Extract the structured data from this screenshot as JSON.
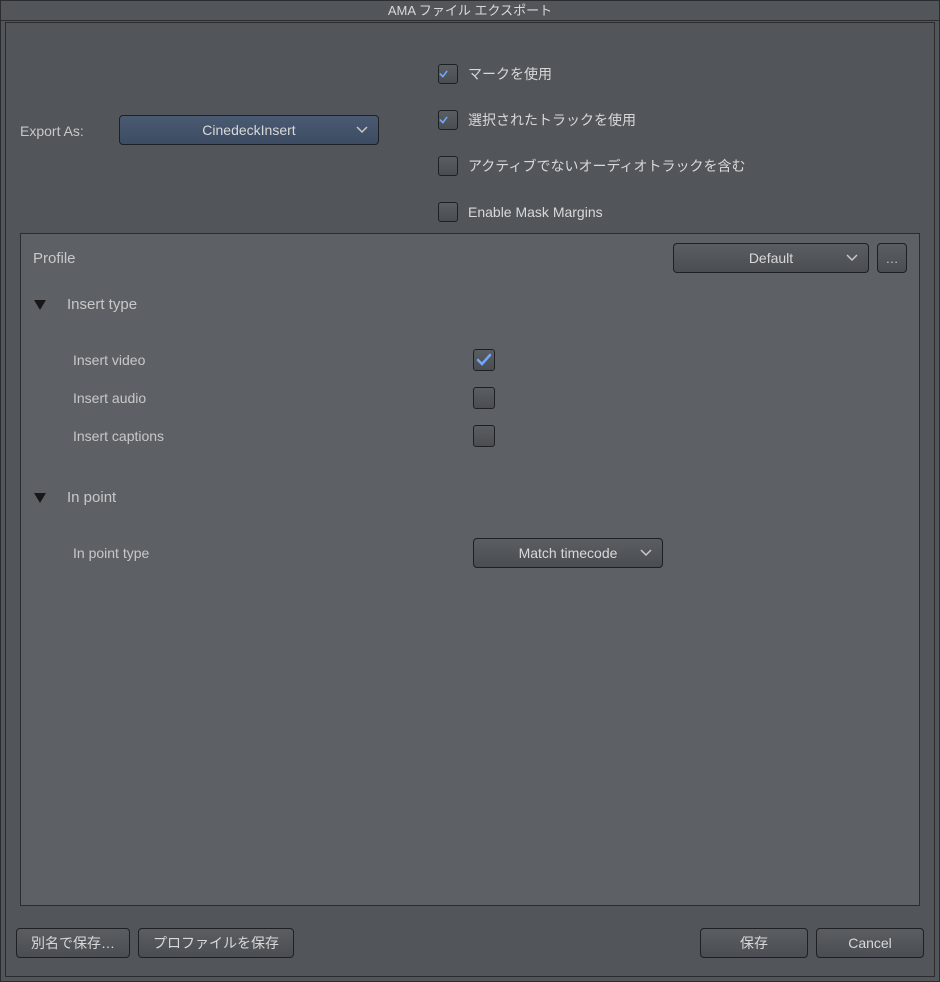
{
  "title": "AMA ファイル エクスポート",
  "export_as": {
    "label": "Export As:",
    "value": "CinedeckInsert"
  },
  "top_options": {
    "use_marks": {
      "label": "マークを使用",
      "checked": true
    },
    "use_selected_tracks": {
      "label": "選択されたトラックを使用",
      "checked": true
    },
    "include_inactive_audio": {
      "label": "アクティブでないオーディオトラックを含む",
      "checked": false
    },
    "enable_mask_margins": {
      "label": "Enable Mask Margins",
      "checked": false
    }
  },
  "profile": {
    "label": "Profile",
    "value": "Default",
    "ellipsis": "…"
  },
  "sections": {
    "insert_type": {
      "title": "Insert type",
      "insert_video": {
        "label": "Insert video",
        "checked": true
      },
      "insert_audio": {
        "label": "Insert audio",
        "checked": false
      },
      "insert_captions": {
        "label": "Insert captions",
        "checked": false
      }
    },
    "in_point": {
      "title": "In point",
      "in_point_type": {
        "label": "In point type",
        "value": "Match timecode"
      }
    }
  },
  "buttons": {
    "save_as": "別名で保存…",
    "save_profile": "プロファイルを保存",
    "save": "保存",
    "cancel": "Cancel"
  }
}
